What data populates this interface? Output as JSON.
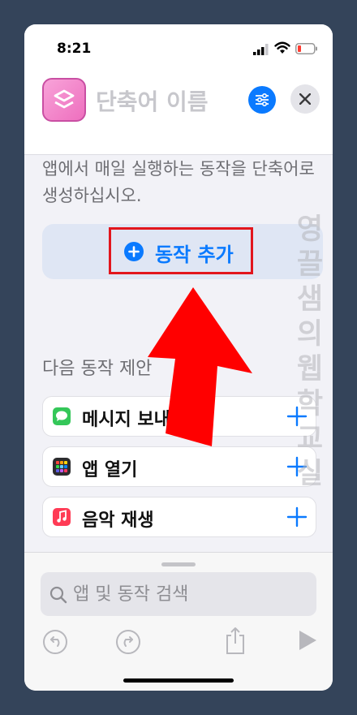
{
  "status_bar": {
    "time": "8:21"
  },
  "header": {
    "shortcut_name": "단축어 이름"
  },
  "intro_text": "앱에서 매일 실행하는 동작을 단축어로 생성하십시오.",
  "add_action": {
    "label": "동작 추가"
  },
  "suggestions": {
    "title": "다음 동작 제안",
    "items": [
      {
        "label": "메시지 보내기",
        "icon": "messages-icon"
      },
      {
        "label": "앱 열기",
        "icon": "app-grid-icon"
      },
      {
        "label": "음악 재생",
        "icon": "music-icon"
      }
    ]
  },
  "search": {
    "placeholder": "앱 및 동작 검색"
  },
  "watermark": "영끌샘의 웹학교실",
  "colors": {
    "accent": "#0a7aff",
    "highlight_box": "#e2161d",
    "arrow": "#ff0000"
  }
}
